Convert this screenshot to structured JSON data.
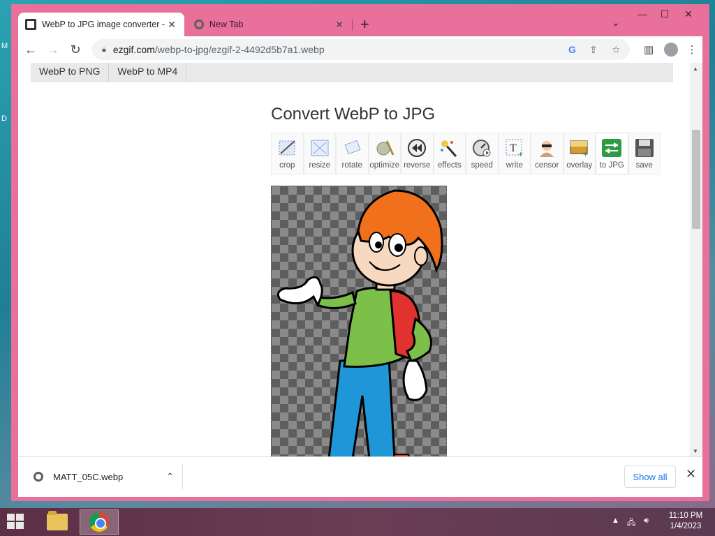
{
  "desktop": {
    "glyph_1": "M",
    "glyph_2": "D"
  },
  "browser": {
    "tabs": [
      {
        "title": "WebP to JPG image converter - M",
        "active": true
      },
      {
        "title": "New Tab",
        "active": false
      }
    ],
    "new_tab_label": "+",
    "address": {
      "domain": "ezgif.com",
      "path": "/webp-to-jpg/ezgif-2-4492d5b7a1.webp"
    },
    "icons": [
      "back-arrow-icon",
      "forward-arrow-icon",
      "reload-icon",
      "lock-icon",
      "google-icon",
      "share-icon",
      "star-icon",
      "side-panel-icon",
      "profile-icon",
      "menu-icon"
    ]
  },
  "page": {
    "subnav": [
      "WebP to PNG",
      "WebP to MP4"
    ],
    "title": "Convert WebP to JPG",
    "tools": [
      {
        "label": "crop",
        "icon": "crop-icon"
      },
      {
        "label": "resize",
        "icon": "resize-icon"
      },
      {
        "label": "rotate",
        "icon": "rotate-icon"
      },
      {
        "label": "optimize",
        "icon": "optimize-icon"
      },
      {
        "label": "reverse",
        "icon": "reverse-icon"
      },
      {
        "label": "effects",
        "icon": "effects-wand-icon"
      },
      {
        "label": "speed",
        "icon": "speed-icon"
      },
      {
        "label": "write",
        "icon": "write-text-icon"
      },
      {
        "label": "censor",
        "icon": "censor-icon"
      },
      {
        "label": "overlay",
        "icon": "overlay-icon"
      },
      {
        "label": "to JPG",
        "icon": "convert-arrows-icon"
      },
      {
        "label": "save",
        "icon": "floppy-disk-icon"
      }
    ]
  },
  "downloads": {
    "file_name": "MATT_05C.webp",
    "show_all": "Show all"
  },
  "taskbar": {
    "time": "11:10 PM",
    "date": "1/4/2023"
  },
  "colors": {
    "window_frame": "#e8709a",
    "link_blue": "#1a73e8",
    "taskbar": "#5c2f47"
  }
}
